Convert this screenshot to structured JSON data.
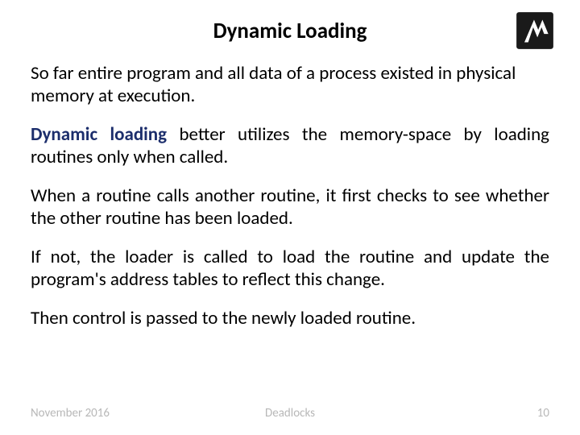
{
  "title": "Dynamic Loading",
  "logo_name": "technion-logo",
  "paragraphs": {
    "p1": "So far entire program and all data of a process existed in physical memory at execution.",
    "p2_lead": "Dynamic loading",
    "p2_rest": " better utilizes the memory-space by loading routines only when called.",
    "p3": "When a routine calls another routine, it first checks to see whether the other routine has been loaded.",
    "p4": "If not, the loader is called to load the routine and update the program's address tables to reflect this change.",
    "p5": "Then control is passed to the newly loaded routine."
  },
  "footer": {
    "date": "November 2016",
    "topic": "Deadlocks",
    "page": "10"
  }
}
